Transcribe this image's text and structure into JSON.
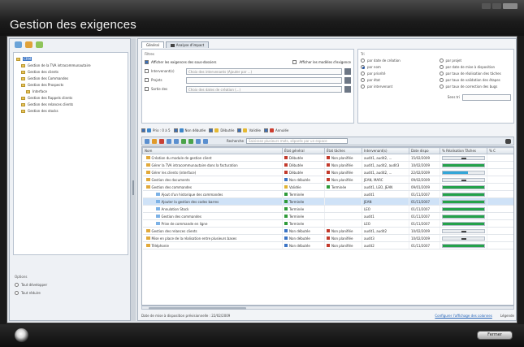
{
  "app": {
    "title": "Gestion des exigences"
  },
  "tree": {
    "items": [
      {
        "label": "CRM",
        "level": 0,
        "selected": true
      },
      {
        "label": "Gestion de la TVA intracommunautaire",
        "level": 1
      },
      {
        "label": "Gestion des clients",
        "level": 1
      },
      {
        "label": "Gestion des Commandes",
        "level": 1
      },
      {
        "label": "Gestion des Prospects",
        "level": 1
      },
      {
        "label": "Interface",
        "level": 2
      },
      {
        "label": "Gestion des Rappels clients",
        "level": 1
      },
      {
        "label": "Gestion des relances clients",
        "level": 1
      },
      {
        "label": "Gestion des stocks",
        "level": 1
      }
    ]
  },
  "options": {
    "title": "Options",
    "items": [
      {
        "label": "Tout développer",
        "on": false
      },
      {
        "label": "Tout réduire",
        "on": false
      }
    ]
  },
  "tabs": [
    {
      "label": "Général",
      "active": true
    },
    {
      "label": "Analyse d'impact",
      "active": false
    }
  ],
  "filters": {
    "group": "Filtres",
    "show_sub": "Afficher les exigences des sous-dossiers",
    "show_hidden": "Afficher les modèles d'exigence",
    "fields": [
      {
        "label": "Intervenant(s)",
        "placeholder": "Choix des intervenants (Ajouter par ...)"
      },
      {
        "label": "Projets",
        "placeholder": ""
      },
      {
        "label": "Sortie des",
        "placeholder": "Choix des dates de création (...)"
      }
    ]
  },
  "sort": {
    "group": "Tri",
    "items": [
      {
        "label": "par date de création",
        "on": false
      },
      {
        "label": "par projet",
        "on": false
      },
      {
        "label": "par nom",
        "on": true
      },
      {
        "label": "par date de mise à disposition",
        "on": false
      },
      {
        "label": "par priorité",
        "on": false
      },
      {
        "label": "par taux de réalisation des tâches",
        "on": false
      },
      {
        "label": "par état",
        "on": false
      },
      {
        "label": "par taux de validation des étapes",
        "on": false
      },
      {
        "label": "par intervenant",
        "on": false
      },
      {
        "label": "par taux de correction des bugs",
        "on": false
      }
    ],
    "order_label": "Sens tri"
  },
  "toolbar": {
    "items": [
      {
        "label": "Prio : 0 à 5"
      },
      {
        "label": "Non débutée"
      },
      {
        "label": "Débutée"
      },
      {
        "label": "Validée"
      },
      {
        "label": "Annulée"
      }
    ]
  },
  "grid_toolbar": {
    "search_label": "Recherche",
    "search_placeholder": "Saisissez plusieurs mots, séparés par un espace"
  },
  "table": {
    "headers": [
      "Nom",
      "État général",
      "État tâches",
      "Intervenant(s)",
      "Date dispo",
      "% Réalisation Tâches",
      "% C"
    ],
    "rows": [
      {
        "name": "Création du module de gestion client",
        "sub": false,
        "state": "Débutée",
        "sc": "r",
        "tasks": "Non planifiée",
        "tc": "r",
        "who": "audit1, audit2, ...",
        "date": "15/02/2009",
        "pct": 0,
        "bar": "dash"
      },
      {
        "name": "Gérer la TVA intracommunautaire dans la facturation",
        "sub": false,
        "state": "Débutée",
        "sc": "r",
        "tasks": "Non planifiée",
        "tc": "r",
        "who": "audit1, audit2, audit3",
        "date": "10/02/2009",
        "pct": 100,
        "bar": "green"
      },
      {
        "name": "Gérer les clients (interface)",
        "sub": false,
        "state": "Débutée",
        "sc": "r",
        "tasks": "Non planifiée",
        "tc": "r",
        "who": "audit1, audit2, ...",
        "date": "22/02/2009",
        "pct": 60,
        "bar": "blue"
      },
      {
        "name": "Gestion des documents",
        "sub": false,
        "state": "Non débutée",
        "sc": "b",
        "tasks": "Non planifiée",
        "tc": "r",
        "who": "JEAN, MARC",
        "date": "09/02/2009",
        "pct": 0,
        "bar": "dash"
      },
      {
        "name": "Gestion des commandes",
        "sub": false,
        "state": "Validée",
        "sc": "y",
        "tasks": "Terminée",
        "tc": "g",
        "who": "audit1, LEO, JEAN",
        "date": "09/01/2009",
        "pct": 100,
        "bar": "green"
      },
      {
        "name": "Ajout d'un historique des commandes",
        "sub": true,
        "state": "Terminée",
        "sc": "g",
        "tasks": "",
        "tc": "",
        "who": "audit1",
        "date": "01/11/2007",
        "pct": 100,
        "bar": "green"
      },
      {
        "name": "Ajouter la gestion des codes barres",
        "sub": true,
        "state": "Terminée",
        "sc": "g",
        "tasks": "",
        "tc": "",
        "who": "JEAN",
        "date": "01/11/2007",
        "pct": 100,
        "bar": "green",
        "selected": true
      },
      {
        "name": "Annulation Stock",
        "sub": true,
        "state": "Terminée",
        "sc": "g",
        "tasks": "",
        "tc": "",
        "who": "LEO",
        "date": "01/11/2007",
        "pct": 100,
        "bar": "green"
      },
      {
        "name": "Gestion des commandes",
        "sub": true,
        "state": "Terminée",
        "sc": "g",
        "tasks": "",
        "tc": "",
        "who": "audit1",
        "date": "01/11/2007",
        "pct": 100,
        "bar": "green"
      },
      {
        "name": "Prise de commande en ligne",
        "sub": true,
        "state": "Terminée",
        "sc": "g",
        "tasks": "",
        "tc": "",
        "who": "LEO",
        "date": "01/11/2007",
        "pct": 100,
        "bar": "green"
      },
      {
        "name": "Gestion des relances clients",
        "sub": false,
        "state": "Non débutée",
        "sc": "b",
        "tasks": "Non planifiée",
        "tc": "r",
        "who": "audit1, audit2",
        "date": "10/02/2009",
        "pct": 0,
        "bar": "dash"
      },
      {
        "name": "Mise en place de la réalisation entre plusieurs bases",
        "sub": false,
        "state": "Non débutée",
        "sc": "b",
        "tasks": "Non planifiée",
        "tc": "r",
        "who": "audit3",
        "date": "10/02/2009",
        "pct": 0,
        "bar": "dash"
      },
      {
        "name": "Téléphonie",
        "sub": false,
        "state": "Non débutée",
        "sc": "b",
        "tasks": "Non planifiée",
        "tc": "r",
        "who": "audit2",
        "date": "01/11/2007",
        "pct": 100,
        "bar": "green"
      }
    ]
  },
  "status": {
    "text": "Date de mise à disposition prévisionnelle : 22/02/2009",
    "link": "Configurer l'affichage des colonnes",
    "legend": "Légende"
  },
  "bottom": {
    "button": "Fermer"
  },
  "colors": {
    "accent": "#3f78c8",
    "done": "#24a24a",
    "progress": "#32a6d8"
  }
}
